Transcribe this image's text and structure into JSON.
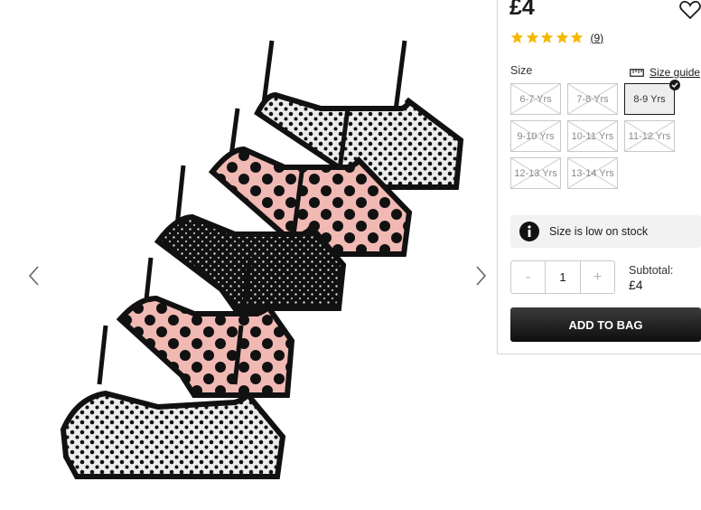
{
  "product": {
    "price": "£4",
    "rating": {
      "stars": 5,
      "review_count": "(9)"
    }
  },
  "size_section": {
    "label": "Size",
    "guide_label": "Size guide",
    "options": [
      {
        "label": "6-7 Yrs",
        "available": false,
        "selected": false
      },
      {
        "label": "7-8 Yrs",
        "available": false,
        "selected": false
      },
      {
        "label": "8-9 Yrs",
        "available": true,
        "selected": true
      },
      {
        "label": "9-10 Yrs",
        "available": false,
        "selected": false
      },
      {
        "label": "10-11 Yrs",
        "available": false,
        "selected": false
      },
      {
        "label": "11-12 Yrs",
        "available": false,
        "selected": false
      },
      {
        "label": "12-13 Yrs",
        "available": false,
        "selected": false
      },
      {
        "label": "13-14 Yrs",
        "available": false,
        "selected": false
      }
    ]
  },
  "stock_message": "Size is low on stock",
  "quantity": {
    "decrement": "-",
    "value": "1",
    "increment": "+"
  },
  "subtotal": {
    "label": "Subtotal:",
    "value": "£4"
  },
  "add_to_bag_label": "ADD TO BAG",
  "colors": {
    "star": "#f5b800",
    "button": "#1a1a1a",
    "pink": "#f0b9b4"
  }
}
